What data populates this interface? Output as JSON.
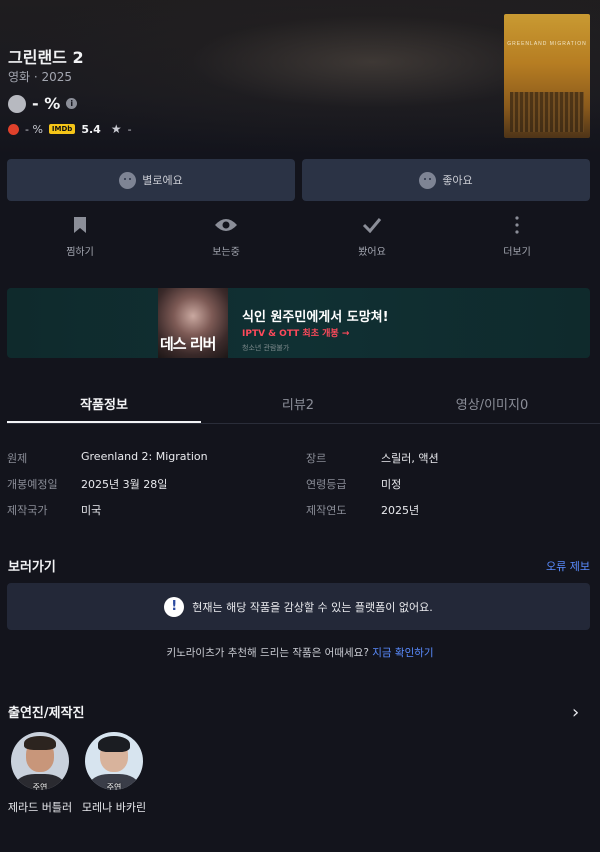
{
  "movie": {
    "title": "그린랜드 2",
    "meta": "영화 · 2025",
    "rating": "- %",
    "tomato_score": "- %",
    "imdb_label": "IMDb",
    "imdb_score": "5.4",
    "star_score": "-",
    "poster_text": "GREENLAND MIGRATION"
  },
  "reactions": {
    "dislike": "별로에요",
    "like": "좋아요"
  },
  "actions": [
    {
      "label": "찜하기",
      "icon": "bookmark-icon"
    },
    {
      "label": "보는중",
      "icon": "eye-icon"
    },
    {
      "label": "봤어요",
      "icon": "check-icon"
    },
    {
      "label": "더보기",
      "icon": "more-vertical-icon"
    }
  ],
  "banner": {
    "image_text": "데스 리버",
    "headline": "식인 원주민에게서 도망쳐!",
    "sub": "IPTV & OTT 최초 개봉 →",
    "rating_note": "청소년 관람불가"
  },
  "tabs": [
    "작품정보",
    "리뷰2",
    "영상/이미지0"
  ],
  "info": {
    "rows": [
      {
        "k1": "원제",
        "v1": "Greenland 2: Migration",
        "k2": "장르",
        "v2": "스릴러, 액션"
      },
      {
        "k1": "개봉예정일",
        "v1": "2025년 3월 28일",
        "k2": "연령등급",
        "v2": "미정"
      },
      {
        "k1": "제작국가",
        "v1": "미국",
        "k2": "제작연도",
        "v2": "2025년"
      }
    ]
  },
  "watch": {
    "title": "보러가기",
    "report": "오류 제보",
    "notice": "현재는 해당 작품을 감상할 수 있는 플랫폼이 없어요.",
    "recommend_text": "키노라이츠가 추천해 드리는 작품은 어때세요?",
    "recommend_link": "지금 확인하기"
  },
  "cast": {
    "title": "출연진/제작진",
    "members": [
      {
        "role": "주연",
        "name": "제라드 버틀러"
      },
      {
        "role": "주연",
        "name": "모레나 바카린"
      }
    ]
  },
  "colors": {
    "background": "#13141c",
    "button": "#2b3345",
    "accent_link": "#5a8cff",
    "banner_highlight": "#ff4a5b"
  }
}
